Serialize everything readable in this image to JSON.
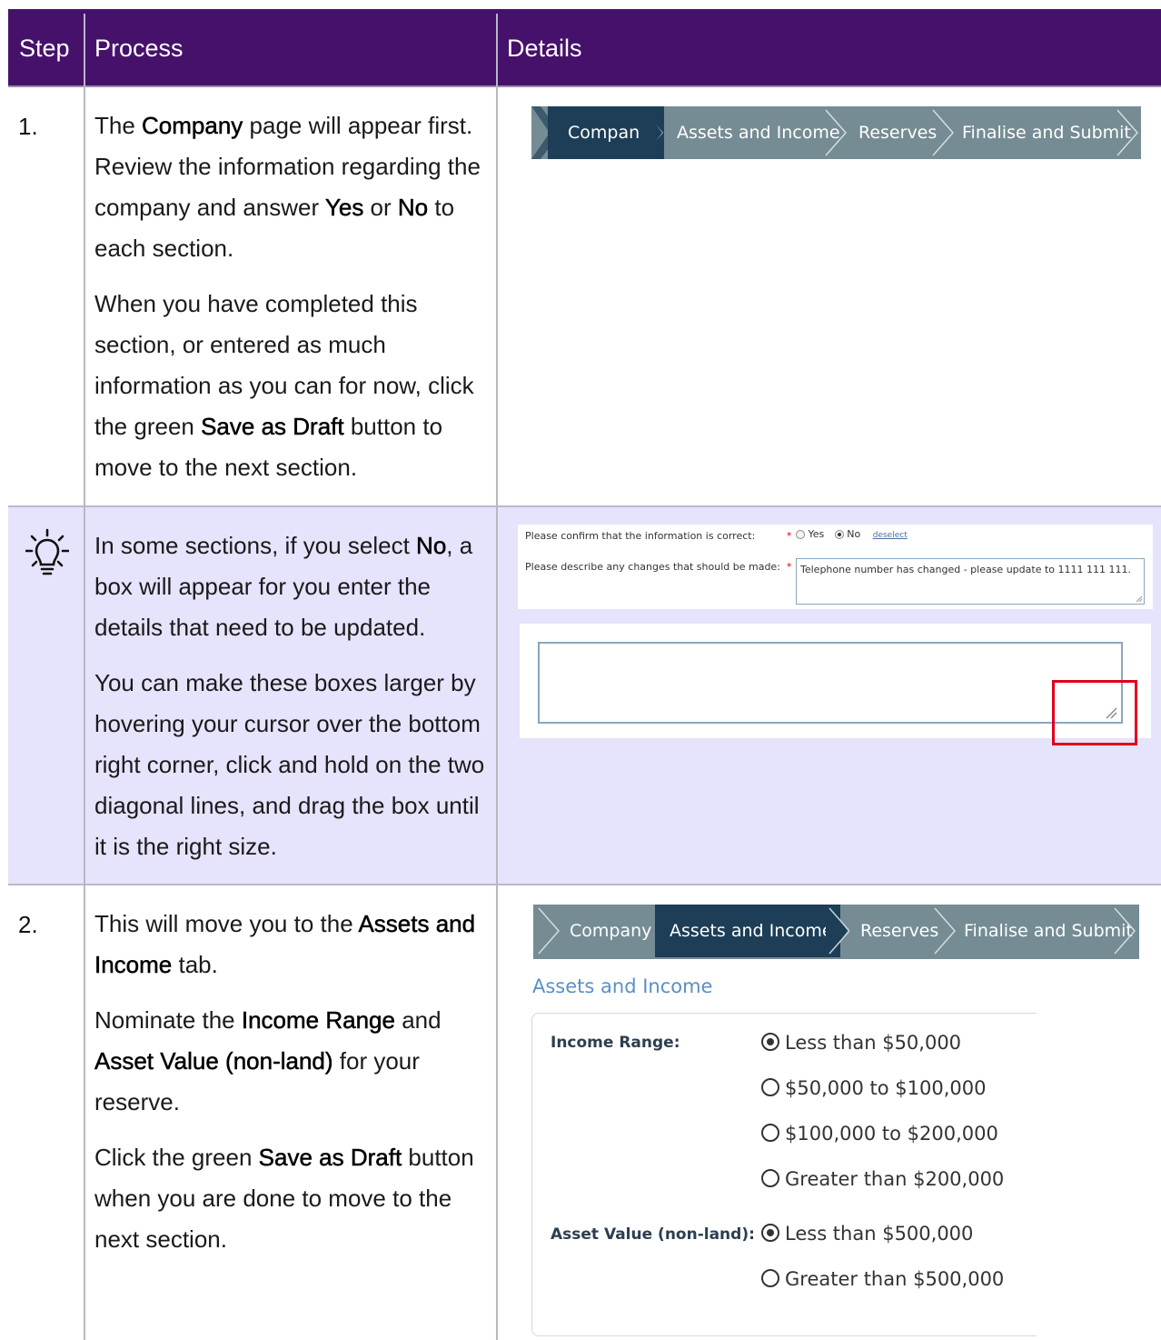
{
  "header": {
    "step": "Step",
    "process": "Process",
    "details": "Details"
  },
  "step1": {
    "number": "1.",
    "p1": {
      "a": "The ",
      "b": "Company",
      "c": " page will appear first. Review the information regarding the company and answer ",
      "d": "Yes",
      "e": " or ",
      "f": "No",
      "g": " to each section."
    },
    "p2": {
      "a": "When you have completed this section, or entered as much information as you can for now, click the green ",
      "b": "Save as Draft",
      "c": " button to move to the next section."
    },
    "crumbs": [
      "Company",
      "Assets and Income",
      "Reserves",
      "Finalise and Submit"
    ]
  },
  "tip": {
    "icon": "lightbulb-icon",
    "p1": {
      "a": "In some sections, if you select ",
      "b": "No",
      "c": ", a box will appear for you enter the details that need to be updated."
    },
    "p2": "You can make these boxes larger by hovering your cursor over the bottom right corner, click and hold on the two diagonal lines, and drag the box until it is the right size.",
    "form": {
      "confirm_label": "Please confirm that the information is correct:",
      "yes": "Yes",
      "no": "No",
      "deselect": "deselect",
      "describe_label": "Please describe any changes that should be made:",
      "describe_value": "Telephone number has changed - please update to 1111 111 111.",
      "required": "*"
    },
    "highlight_color": "#e0001b"
  },
  "step2": {
    "number": "2.",
    "p1": {
      "a": "This will move you to the ",
      "b": "Assets and Income",
      "c": " tab."
    },
    "p2": {
      "a": "Nominate the ",
      "b": "Income Range",
      "c": " and ",
      "d": "Asset Value (non-land)",
      "e": " for your reserve."
    },
    "p3": {
      "a": "Click the green ",
      "b": "Save as Draft",
      "c": " button when you are done to move to the next section."
    },
    "crumbs": [
      "Company",
      "Assets and Income",
      "Reserves",
      "Finalise and Submit"
    ],
    "section_title": "Assets and Income",
    "income_label": "Income Range:",
    "income_options": [
      "Less than $50,000",
      "$50,000 to $100,000",
      "$100,000 to $200,000",
      "Greater than $200,000"
    ],
    "asset_label": "Asset Value (non-land):",
    "asset_options": [
      "Less than $500,000",
      "Greater than $500,000"
    ]
  },
  "colors": {
    "header_bg": "#46116b",
    "tip_bg": "#e6e3fc",
    "crumb_bg": "#758c94",
    "crumb_active": "#1d3e56"
  }
}
